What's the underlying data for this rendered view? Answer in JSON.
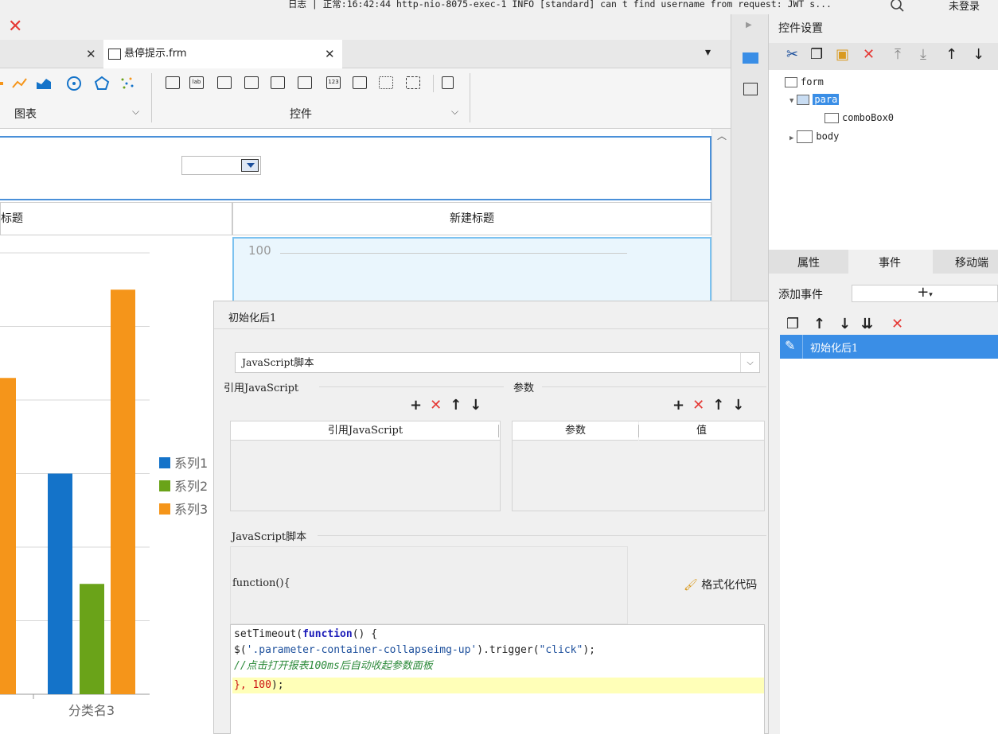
{
  "status": {
    "log_text": "日志 | 正常:16:42:44 http-nio-8075-exec-1 INFO [standard] can t find username from request: JWT s...",
    "user": "未登录"
  },
  "tabs": [
    {
      "label": "悬停提示.frm"
    }
  ],
  "ribbon": {
    "group_chart": "图表",
    "group_controls": "控件"
  },
  "canvas": {
    "title_left": "标题",
    "title_right": "新建标题",
    "right_axis_max": "100"
  },
  "chart_data": {
    "type": "bar",
    "categories": [
      "分类名3"
    ],
    "series": [
      {
        "name": "系列1",
        "color": "#1473c9",
        "values": [
          3000
        ]
      },
      {
        "name": "系列2",
        "color": "#6aa319",
        "values": [
          1500
        ]
      },
      {
        "name": "系列3",
        "color": "#f5951a",
        "values": [
          5500
        ]
      }
    ],
    "ylim": [
      0,
      6000
    ],
    "grid": true,
    "legend": "right"
  },
  "right_panel": {
    "title": "控件设置",
    "tree": [
      {
        "label": "form"
      },
      {
        "label": "para"
      },
      {
        "label": "comboBox0"
      },
      {
        "label": "body"
      }
    ],
    "prop_tabs": [
      "属性",
      "事件",
      "移动端"
    ],
    "add_event_label": "添加事件",
    "event_item": "初始化后1"
  },
  "dialog": {
    "title": "初始化后1",
    "type_select": "JavaScript脚本",
    "ref_js_section": "引用JavaScript",
    "param_section": "参数",
    "ref_js_header": "引用JavaScript",
    "param_header": "参数",
    "value_header": "值",
    "script_section": "JavaScript脚本",
    "fn_signature": "function(){",
    "format_button": "格式化代码",
    "code": {
      "l1a": "setTimeout(",
      "l1b": "function",
      "l1c": "() {",
      "l2a": "$(",
      "l2b": "'.parameter-container-collapseimg-up'",
      "l2c": ").trigger(",
      "l2d": "\"click\"",
      "l2e": ");",
      "l3": "//点击打开报表100ms后自动收起参数面板",
      "l4a": "}, 100",
      "l4b": ");"
    }
  }
}
